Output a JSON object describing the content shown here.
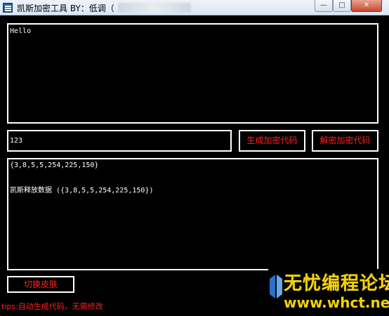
{
  "window": {
    "title": "凯斯加密工具  BY：低调（",
    "minimize_glyph": "—",
    "maximize_glyph": "□",
    "close_glyph": "✕",
    "icon": "app-icon"
  },
  "input_area": {
    "value": "Hello"
  },
  "key_field": {
    "value": "123"
  },
  "buttons": {
    "generate": "生成加密代码",
    "decrypt": "解密加密代码",
    "switch_skin": "切换皮肤"
  },
  "output_area": {
    "value": "{3,8,5,5,254,225,150}\n\n\n凯斯释放数据 ({3,8,5,5,254,225,150})"
  },
  "tips": "tips:自动生成代码，无需修改",
  "watermark": {
    "title": "无忧编程论坛",
    "url": "www.whct.net"
  },
  "colors": {
    "background": "#000000",
    "button_text": "#ff2020",
    "border": "#ffffff",
    "watermark": "#f1d20a"
  }
}
